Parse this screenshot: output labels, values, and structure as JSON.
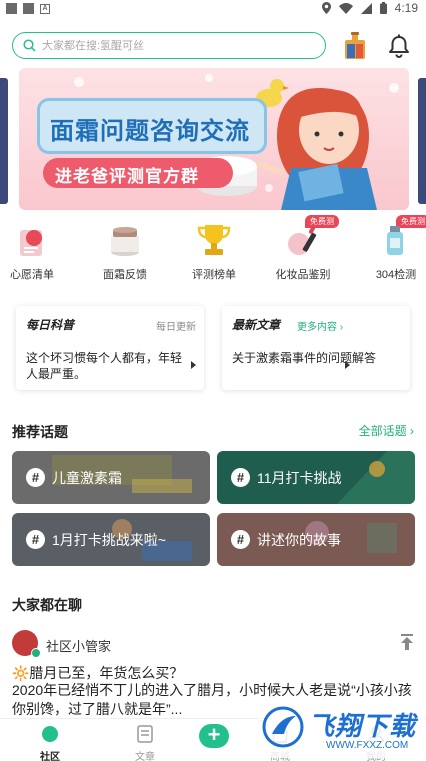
{
  "status_bar": {
    "time": "4:19"
  },
  "search": {
    "placeholder": "大家都在搜:氢醌可丝"
  },
  "banner": {
    "title": "面霜问题咨询交流",
    "subtitle": "进老爸评测官方群"
  },
  "quick_icons": [
    {
      "label": "心愿清单",
      "tag": ""
    },
    {
      "label": "面霜反馈",
      "tag": ""
    },
    {
      "label": "评测榜单",
      "tag": ""
    },
    {
      "label": "化妆品鉴别",
      "tag": "免费测"
    },
    {
      "label": "304检测",
      "tag": "免费测"
    }
  ],
  "cards": [
    {
      "title": "每日科普",
      "more": "每日更新",
      "text": "这个坏习惯每个人都有，年轻人最严重。"
    },
    {
      "title": "最新文章",
      "more": "更多内容",
      "text": "关于激素霜事件的问题解答"
    }
  ],
  "topics": {
    "section_title": "推荐话题",
    "all_link": "全部话题",
    "items": [
      {
        "label": "儿童激素霜",
        "color": "#6b6b6b"
      },
      {
        "label": "11月打卡挑战",
        "color": "#1f5e4e"
      },
      {
        "label": "1月打卡挑战来啦~",
        "color": "#5a5f66"
      },
      {
        "label": "讲述你的故事",
        "color": "#7a5a52"
      }
    ]
  },
  "feed": {
    "section_title": "大家都在聊",
    "post": {
      "user": "社区小管家",
      "title": "🔆腊月已至，年货怎么买？",
      "body": "2020年已经悄不丁儿的进入了腊月，小时候大人老是说“小孩小孩你别馋，过了腊八就是年”..."
    }
  },
  "bottom_nav": [
    {
      "label": "社区",
      "active": true
    },
    {
      "label": "文章",
      "active": false
    },
    {
      "label": "商城",
      "active": false
    },
    {
      "label": "我的",
      "active": false
    }
  ],
  "watermark": {
    "big": "飞翔下载",
    "small": "WWW.FXXZ.COM"
  },
  "colors": {
    "accent": "#22c08d",
    "tag_red": "#e8475a"
  }
}
